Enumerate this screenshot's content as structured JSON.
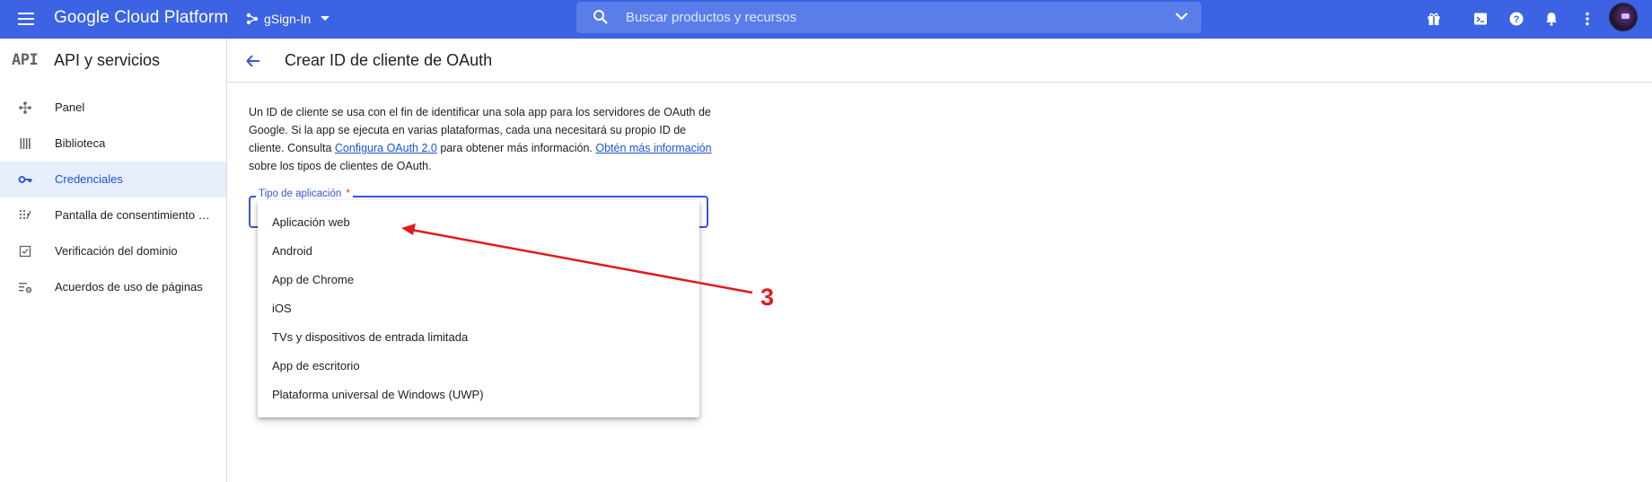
{
  "topbar": {
    "brand": "Google Cloud Platform",
    "project": "gSign-In",
    "search_placeholder": "Buscar productos y recursos",
    "icons": [
      "menu-icon",
      "gift-icon",
      "terminal-icon",
      "help-icon",
      "bell-icon",
      "more-vert-icon",
      "avatar"
    ]
  },
  "sidebar": {
    "logo": "API",
    "title": "API y servicios",
    "items": [
      {
        "label": "Panel",
        "icon": "dashboard-icon"
      },
      {
        "label": "Biblioteca",
        "icon": "library-icon"
      },
      {
        "label": "Credenciales",
        "icon": "key-icon",
        "active": true
      },
      {
        "label": "Pantalla de consentimiento de OAuth",
        "icon": "consent-icon"
      },
      {
        "label": "Verificación del dominio",
        "icon": "check-box-icon"
      },
      {
        "label": "Acuerdos de uso de páginas",
        "icon": "settings-list-icon"
      }
    ]
  },
  "header": {
    "title": "Crear ID de cliente de OAuth"
  },
  "description": {
    "part1": "Un ID de cliente se usa con el fin de identificar una sola app para los servidores de OAuth de Google. Si la app se ejecuta en varias plataformas, cada una necesitará su propio ID de cliente. Consulta ",
    "link1": "Configura OAuth 2.0",
    "part2": " para obtener más información. ",
    "link2": "Obtén más información",
    "part3": " sobre los tipos de clientes de OAuth."
  },
  "form": {
    "app_type_label": "Tipo de aplicación",
    "required_marker": "*",
    "options": [
      "Aplicación web",
      "Android",
      "App de Chrome",
      "iOS",
      "TVs y dispositivos de entrada limitada",
      "App de escritorio",
      "Plataforma universal de Windows (UWP)"
    ]
  },
  "annotation": {
    "number": "3",
    "color": "#e31919"
  },
  "colors": {
    "topbar": "#3b63e4",
    "accent": "#3b55d9",
    "link": "#1a53d6",
    "active_bg": "#e8eefc"
  }
}
